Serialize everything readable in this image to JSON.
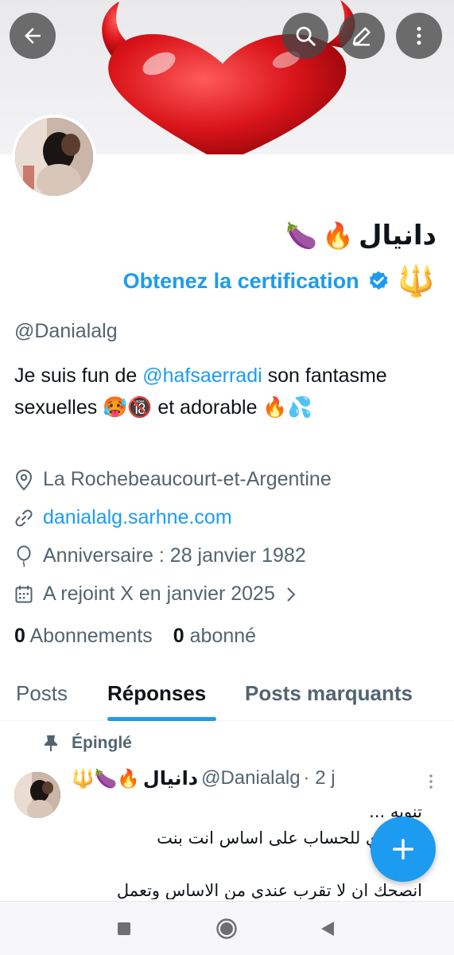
{
  "profile": {
    "display_name": "دانيال",
    "name_emojis": [
      "🔥",
      "🍆"
    ],
    "certification_link": "Obtenez la certification",
    "trident_emoji": "🔱",
    "handle": "@Danialalg",
    "bio": {
      "prefix": "Je suis fun de ",
      "mention": "@hafsaerradi",
      "suffix": " son fantasme sexuelles 🥵🔞 et adorable 🔥💦"
    },
    "location": "La Rochebeaucourt-et-Argentine",
    "website": "danialalg.sarhne.com",
    "birthday": "Anniversaire : 28 janvier 1982",
    "joined": "A rejoint X en janvier 2025",
    "following_count": "0",
    "following_label": "Abonnements",
    "followers_count": "0",
    "followers_label": "abonné"
  },
  "icons": {
    "back": "arrow-left-icon",
    "search": "search-icon",
    "edit": "edit-pen-icon",
    "more": "more-vertical-icon",
    "location": "location-pin-icon",
    "link": "link-icon",
    "birthday": "balloon-icon",
    "calendar": "calendar-icon",
    "pin": "pin-icon",
    "compose": "plus-icon",
    "verified": "verified-badge-icon"
  },
  "tabs": [
    {
      "label": "Posts",
      "active": false
    },
    {
      "label": "Réponses",
      "active": true
    },
    {
      "label": "Posts marquants",
      "active": false
    }
  ],
  "post": {
    "pinned_label": "Épinglé",
    "emojis": "🔱🍆🔥",
    "author_name": "دانيال",
    "author_handle": "@Danialalg",
    "time": "· 2 j",
    "text": "تنويه ...\nانا عندي  للحساب على اساس انت بنت\nو عليا\nانصحك ان لا تقرب عندي من الاساس وتعمل"
  },
  "colors": {
    "accent": "#1d9bf0",
    "text_primary": "#0f1419",
    "text_secondary": "#536471"
  }
}
